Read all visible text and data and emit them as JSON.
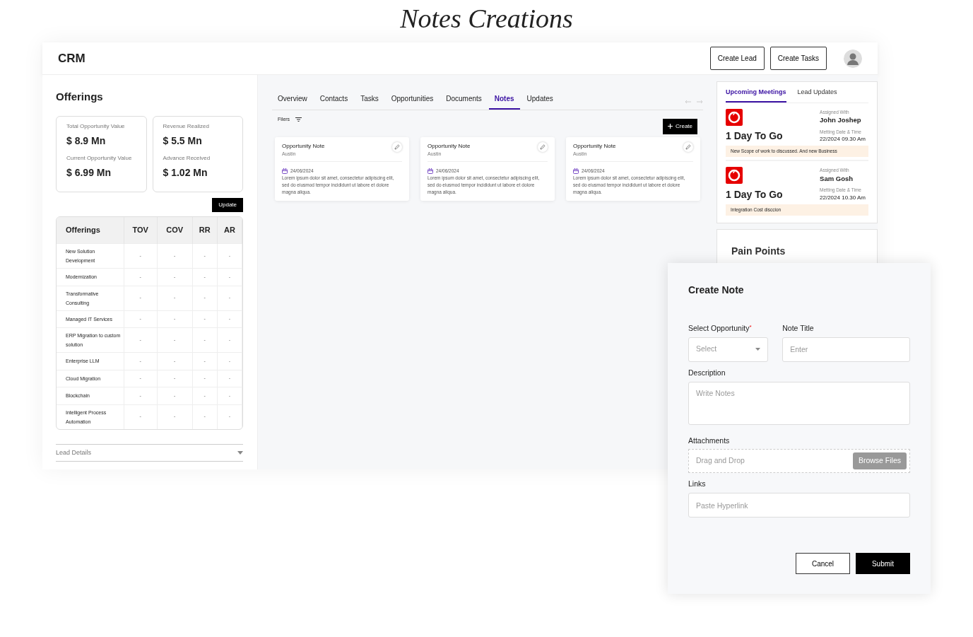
{
  "title": "Notes Creations",
  "header": {
    "brand": "CRM",
    "buttons": [
      "Create Lead",
      "Create Tasks"
    ]
  },
  "offerings": {
    "title": "Offerings",
    "metrics": [
      [
        {
          "label": "Total Opportunity Value",
          "value": "$ 8.9 Mn"
        },
        {
          "label": "Current Opportunity Value",
          "value": "$ 6.99 Mn"
        }
      ],
      [
        {
          "label": "Revenue Realized",
          "value": "$ 5.5 Mn"
        },
        {
          "label": "Advance Received",
          "value": "$ 1.02 Mn"
        }
      ]
    ],
    "update_button": "Update",
    "table": {
      "columns": [
        "Offerings",
        "TOV",
        "COV",
        "RR",
        "AR"
      ],
      "rows": [
        [
          "New Solution Development",
          "-",
          "-",
          "-",
          "-"
        ],
        [
          "Modernization",
          "-",
          "-",
          "-",
          "-"
        ],
        [
          "Transformative Consulting",
          "-",
          "-",
          "-",
          "-"
        ],
        [
          "Managed IT Services",
          "-",
          "-",
          "-",
          "-"
        ],
        [
          "ERP Migration to custom solution",
          "-",
          "-",
          "-",
          "-"
        ],
        [
          "Enterprise LLM",
          "-",
          "-",
          "-",
          "-"
        ],
        [
          "Cloud Migration",
          "-",
          "-",
          "-",
          "-"
        ],
        [
          "Blockchain",
          "-",
          "-",
          "-",
          "-"
        ],
        [
          "Intelligent Process Automation",
          "-",
          "-",
          "-",
          "-"
        ]
      ]
    },
    "lead_details": "Lead Details"
  },
  "tabs": [
    {
      "label": "Overview",
      "selected": false
    },
    {
      "label": "Contacts",
      "selected": false
    },
    {
      "label": "Tasks",
      "selected": false
    },
    {
      "label": "Opportunities",
      "selected": false
    },
    {
      "label": "Documents",
      "selected": false
    },
    {
      "label": "Notes",
      "selected": true
    },
    {
      "label": "Updates",
      "selected": false
    }
  ],
  "filters": "Filers",
  "create_button": "Create",
  "notes": [
    {
      "title": "Opportunity Note",
      "author": "Austin",
      "date": "24/06/2024",
      "body": "Lorem ipsum dolor sit amet, consectetur adipiscing elit, sed do eiusmod tempor incididunt ut labore et dolore magna aliqua."
    },
    {
      "title": "Opportunity Note",
      "author": "Austin",
      "date": "24/06/2024",
      "body": "Lorem ipsum dolor sit amet, consectetur adipiscing elit, sed do eiusmod tempor incididunt ut labore et dolore magna aliqua."
    },
    {
      "title": "Opportunity Note",
      "author": "Austin",
      "date": "24/06/2024",
      "body": "Lorem ipsum dolor sit amet, consectetur adipiscing elit, sed do eiusmod tempor incididunt ut labore et dolore magna aliqua."
    }
  ],
  "meetings_panel": {
    "tabs": [
      {
        "label": "Upcoming Meetings",
        "selected": true
      },
      {
        "label": "Lead Updates",
        "selected": false
      }
    ],
    "meetings": [
      {
        "countdown": "1 Day To Go",
        "assigned_label": "Assigned With",
        "name": "John Joshep",
        "datetime_label": "Metting Date & Time",
        "datetime": "22/2024 09.30 Am",
        "note": "New Scope of work to discussed. And new Business"
      },
      {
        "countdown": "1 Day To Go",
        "assigned_label": "Assigned With",
        "name": "Sam Gosh",
        "datetime_label": "Metting Date & Time",
        "datetime": "22/2024 10.30 Am",
        "note": "Integration Cost disccion"
      }
    ]
  },
  "pain_points": {
    "title": "Pain Points"
  },
  "create_note": {
    "title": "Create Note",
    "opportunity": {
      "label": "Select Opportunity",
      "required_mark": "*",
      "placeholder": "Select"
    },
    "note_title": {
      "label": "Note Title",
      "placeholder": "Enter"
    },
    "description": {
      "label": "Description",
      "placeholder": "Write Notes"
    },
    "attachments": {
      "label": "Attachments",
      "placeholder": "Drag and Drop",
      "button": "Browse Files"
    },
    "links": {
      "label": "Links",
      "placeholder": "Paste Hyperlink"
    },
    "buttons": {
      "cancel": "Cancel",
      "submit": "Submit"
    }
  }
}
